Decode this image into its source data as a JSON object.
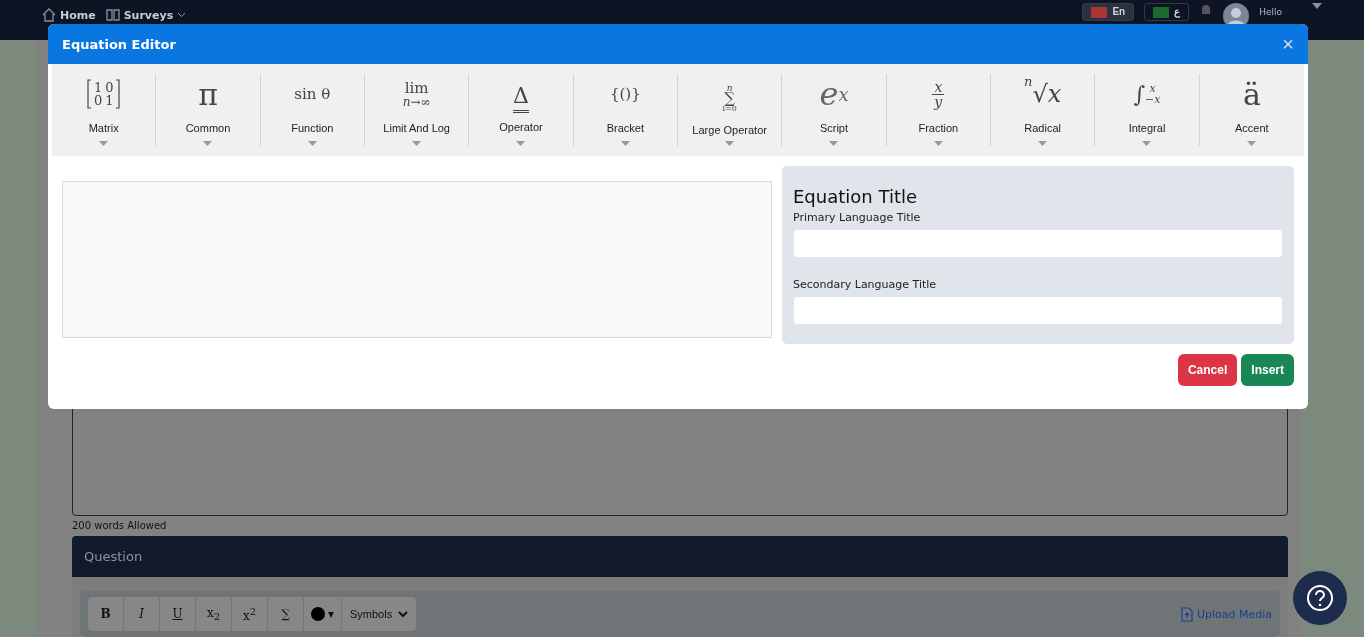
{
  "navbar": {
    "links": [
      {
        "label": "Home",
        "dropdown": false
      },
      {
        "label": "Surveys",
        "dropdown": true
      }
    ],
    "languages": [
      {
        "label": "En",
        "selected": true
      },
      {
        "label": "ع",
        "selected": false
      }
    ],
    "greeting": "Hello"
  },
  "page": {
    "word_limit": "200 words Allowed",
    "question": {
      "title": "Question",
      "format_buttons": [
        {
          "kind": "bold",
          "label": "B"
        },
        {
          "kind": "italic",
          "label": "I"
        },
        {
          "kind": "underline",
          "label": "U"
        },
        {
          "kind": "sub",
          "label": "x",
          "mark": "2"
        },
        {
          "kind": "sup",
          "label": "x",
          "mark": "2"
        },
        {
          "kind": "plain",
          "label": "∑"
        },
        {
          "kind": "color",
          "label": "▾"
        }
      ],
      "symbols_select": "Symbols",
      "upload": "Upload Media"
    }
  },
  "dialog": {
    "title": "Equation Editor",
    "close": "×",
    "tools": [
      {
        "kind": "matrix",
        "parts": [
          "1",
          "0",
          "0",
          "1"
        ],
        "label": "Matrix"
      },
      {
        "kind": "big",
        "parts": [
          "π"
        ],
        "label": "Common"
      },
      {
        "kind": "plain",
        "parts": [
          "sin θ"
        ],
        "label": "Function"
      },
      {
        "kind": "stack",
        "parts": [
          "lim",
          "n→∞"
        ],
        "label": "Limit And Log"
      },
      {
        "kind": "operator",
        "parts": [
          "Δ"
        ],
        "label": "Operator"
      },
      {
        "kind": "plain",
        "parts": [
          "{()}"
        ],
        "label": "Bracket"
      },
      {
        "kind": "stack3",
        "parts": [
          "n",
          "∑",
          "i=0"
        ],
        "label": "Large Operator"
      },
      {
        "kind": "script",
        "parts": [
          "e",
          "x"
        ],
        "label": "Script"
      },
      {
        "kind": "fraction",
        "parts": [
          "x",
          "y"
        ],
        "label": "Fraction"
      },
      {
        "kind": "radical",
        "parts": [
          "n",
          "√x"
        ],
        "label": "Radical"
      },
      {
        "kind": "integral",
        "parts": [
          "∫",
          "x",
          "−x"
        ],
        "label": "Integral"
      },
      {
        "kind": "big",
        "parts": [
          "ä"
        ],
        "label": "Accent"
      }
    ],
    "title_panel": {
      "heading": "Equation Title",
      "fields": [
        {
          "label": "Primary Language Title"
        },
        {
          "label": "Secondary Language Title"
        }
      ]
    },
    "buttons": [
      {
        "kind": "cancel",
        "label": "Cancel"
      },
      {
        "kind": "insert",
        "label": "Insert"
      }
    ]
  }
}
